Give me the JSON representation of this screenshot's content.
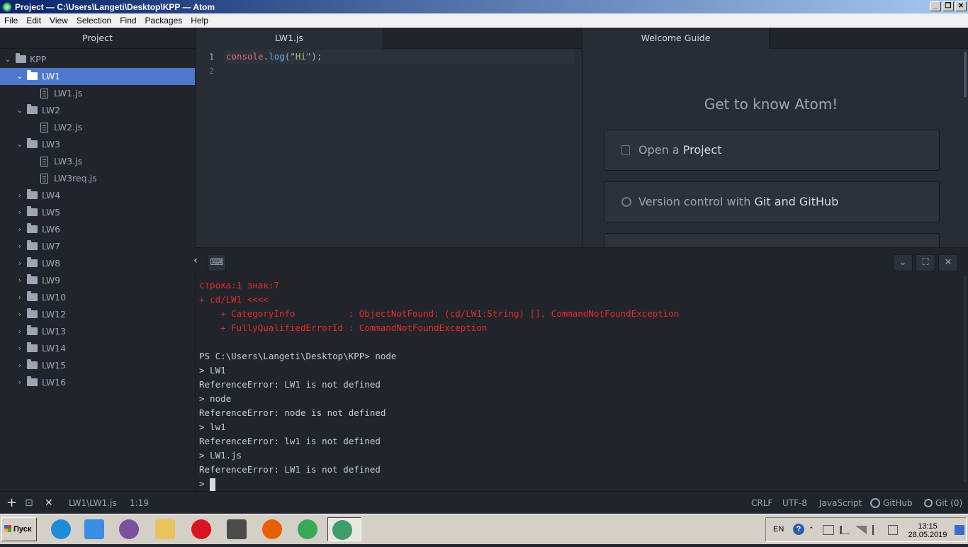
{
  "window": {
    "title": "Project — C:\\Users\\Langeti\\Desktop\\KPP — Atom",
    "buttons": [
      "_",
      "❐",
      "✕"
    ]
  },
  "menu": [
    "File",
    "Edit",
    "View",
    "Selection",
    "Find",
    "Packages",
    "Help"
  ],
  "sidebar": {
    "title": "Project",
    "root": "KPP",
    "items": [
      {
        "label": "LW1",
        "type": "folder",
        "expanded": true,
        "selected": true
      },
      {
        "label": "LW1.js",
        "type": "file"
      },
      {
        "label": "LW2",
        "type": "folder",
        "expanded": true
      },
      {
        "label": "LW2.js",
        "type": "file"
      },
      {
        "label": "LW3",
        "type": "folder",
        "expanded": true
      },
      {
        "label": "LW3.js",
        "type": "file"
      },
      {
        "label": "LW3req.js",
        "type": "file"
      },
      {
        "label": "LW4",
        "type": "folder"
      },
      {
        "label": "LW5",
        "type": "folder"
      },
      {
        "label": "LW6",
        "type": "folder"
      },
      {
        "label": "LW7",
        "type": "folder"
      },
      {
        "label": "LW8",
        "type": "folder"
      },
      {
        "label": "LW9",
        "type": "folder"
      },
      {
        "label": "LW10",
        "type": "folder"
      },
      {
        "label": "LW12",
        "type": "folder"
      },
      {
        "label": "LW13",
        "type": "folder"
      },
      {
        "label": "LW14",
        "type": "folder"
      },
      {
        "label": "LW15",
        "type": "folder"
      },
      {
        "label": "LW16",
        "type": "folder"
      }
    ]
  },
  "editor": {
    "tab": "LW1.js",
    "line_numbers": [
      "1",
      "2"
    ],
    "code": {
      "obj": "console",
      "dot": ".",
      "fn": "log",
      "open": "(",
      "str": "\"Hi\"",
      "close": ");"
    }
  },
  "welcome": {
    "tab": "Welcome Guide",
    "title": "Get to know Atom!",
    "card1": {
      "prefix": "Open a ",
      "bold": "Project"
    },
    "card2": {
      "prefix": "Version control with ",
      "bold": "Git and GitHub"
    }
  },
  "terminal": {
    "buttons": {
      "chevron": "⌄",
      "maximize": "⛶",
      "close": "✕",
      "keyboard": "⌨",
      "collapse": "‹"
    },
    "lines": [
      {
        "text": "строка:1 знак:7",
        "error": true
      },
      {
        "text": "+ cd/LW1 <<<<",
        "error": true
      },
      {
        "text": "    + CategoryInfo          : ObjectNotFound: (cd/LW1:String) [], CommandNotFoundException",
        "error": true
      },
      {
        "text": "    + FullyQualifiedErrorId : CommandNotFoundException",
        "error": true
      },
      {
        "text": "",
        "error": false
      },
      {
        "text": "PS C:\\Users\\Langeti\\Desktop\\KPP> node",
        "error": false
      },
      {
        "text": "> LW1",
        "error": false
      },
      {
        "text": "ReferenceError: LW1 is not defined",
        "error": false
      },
      {
        "text": "> node",
        "error": false
      },
      {
        "text": "ReferenceError: node is not defined",
        "error": false
      },
      {
        "text": "> lw1",
        "error": false
      },
      {
        "text": "ReferenceError: lw1 is not defined",
        "error": false
      },
      {
        "text": "> LW1.js",
        "error": false
      },
      {
        "text": "ReferenceError: LW1 is not defined",
        "error": false
      }
    ],
    "prompt": "> "
  },
  "status": {
    "add": "+",
    "term": "⊡",
    "close": "✕",
    "path": "LW1\\LW1.js",
    "cursor": "1:19",
    "eol": "CRLF",
    "encoding": "UTF-8",
    "grammar": "JavaScript",
    "github": "GitHub",
    "git": "Git (0)"
  },
  "taskbar": {
    "start": "Пуск",
    "apps": [
      {
        "name": "internet-explorer",
        "color": "#1f8ad8"
      },
      {
        "name": "media-player",
        "color": "#3a8ee6"
      },
      {
        "name": "viber",
        "color": "#7b519d"
      },
      {
        "name": "folder",
        "color": "#e8c25a"
      },
      {
        "name": "opera",
        "color": "#d7141f"
      },
      {
        "name": "sublime-text",
        "color": "#4b4b4b"
      },
      {
        "name": "firefox",
        "color": "#e66000"
      },
      {
        "name": "chrome",
        "color": "#3aa757"
      },
      {
        "name": "atom",
        "color": "#3e9e6b"
      }
    ],
    "lang": "EN",
    "time": "13:15",
    "date": "28.05.2019"
  }
}
